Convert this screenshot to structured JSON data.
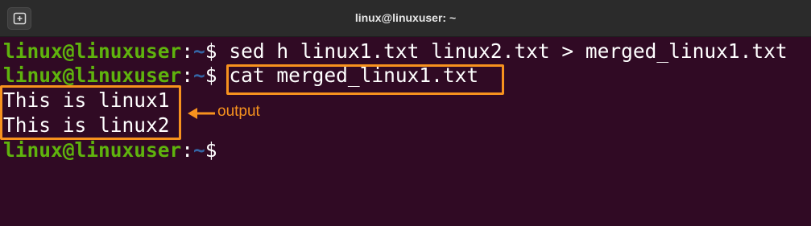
{
  "window": {
    "title": "linux@linuxuser: ~"
  },
  "prompt": {
    "user_host": "linux@linuxuser",
    "separator": ":",
    "path": "~",
    "symbol": "$"
  },
  "lines": [
    {
      "type": "command",
      "text": "sed h linux1.txt linux2.txt > merged_linux1.txt"
    },
    {
      "type": "command",
      "text": "cat merged_linux1.txt"
    },
    {
      "type": "output",
      "text": "This is linux1"
    },
    {
      "type": "output",
      "text": "This is linux2"
    },
    {
      "type": "command",
      "text": ""
    }
  ],
  "annotation": {
    "label": "output"
  },
  "colors": {
    "background": "#300a24",
    "prompt_user": "#5fb30d",
    "prompt_path": "#3465a4",
    "highlight": "#f7921e",
    "titlebar": "#2b2b2b"
  },
  "icons": {
    "new_tab": "new-tab-icon",
    "annotation_arrow": "arrow-left-icon"
  }
}
